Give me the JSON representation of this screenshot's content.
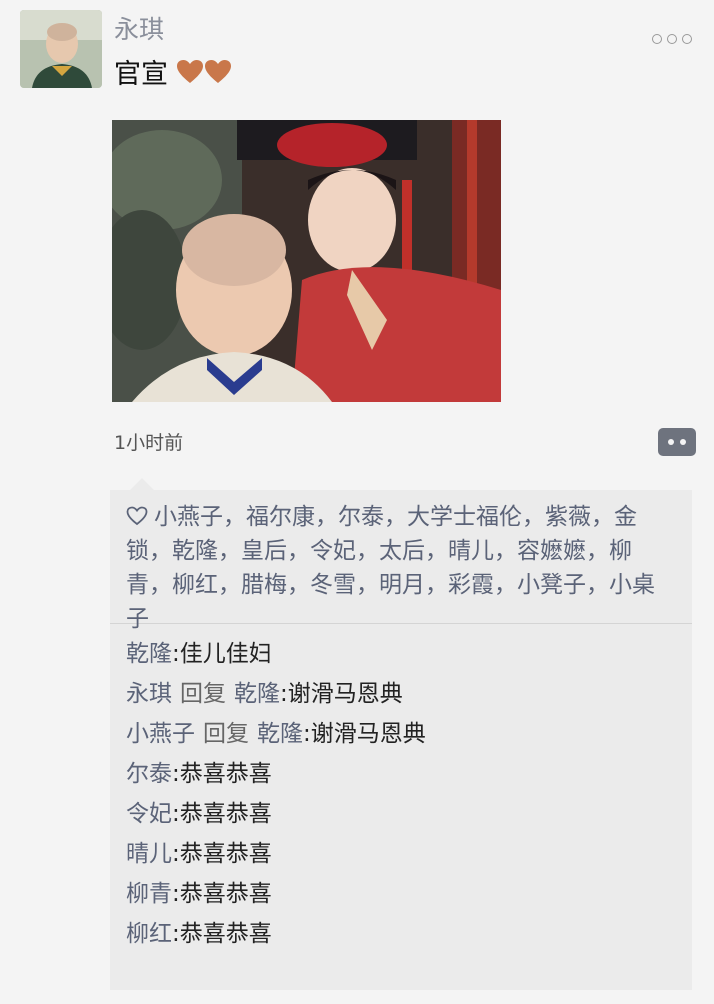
{
  "post": {
    "author": "永琪",
    "text": "官宣",
    "timestamp": "1小时前"
  },
  "likes": {
    "names_text": "小燕子，福尔康，尔泰，大学士福伦，紫薇，金锁，乾隆，皇后，令妃，太后，晴儿，容嬷嬷，柳青，柳红，腊梅，冬雪，明月，彩霞，小凳子，小桌子"
  },
  "comments": [
    {
      "name": "乾隆",
      "reply_label": "",
      "reply_to": "",
      "sep": ":",
      "text": "佳儿佳妇"
    },
    {
      "name": "永琪",
      "reply_label": "回复",
      "reply_to": "乾隆",
      "sep": ":",
      "text": "谢滑马恩典"
    },
    {
      "name": "小燕子",
      "reply_label": "回复",
      "reply_to": "乾隆",
      "sep": ":",
      "text": "谢滑马恩典"
    },
    {
      "name": "尔泰",
      "reply_label": "",
      "reply_to": "",
      "sep": ":",
      "text": "恭喜恭喜"
    },
    {
      "name": "令妃",
      "reply_label": "",
      "reply_to": "",
      "sep": ":",
      "text": "恭喜恭喜"
    },
    {
      "name": "晴儿",
      "reply_label": "",
      "reply_to": "",
      "sep": ":",
      "text": "恭喜恭喜"
    },
    {
      "name": "柳青",
      "reply_label": "",
      "reply_to": "",
      "sep": ":",
      "text": "恭喜恭喜"
    },
    {
      "name": "柳红",
      "reply_label": "",
      "reply_to": "",
      "sep": ":",
      "text": "恭喜恭喜"
    }
  ],
  "icons": {
    "more": "more-dots-icon",
    "comment": "comment-icon",
    "like": "heart-outline-icon",
    "hearts": "heart-emoji-icon"
  },
  "colors": {
    "name_link": "#5b6378",
    "background": "#f4f4f4",
    "comment_area": "#ebebeb"
  }
}
